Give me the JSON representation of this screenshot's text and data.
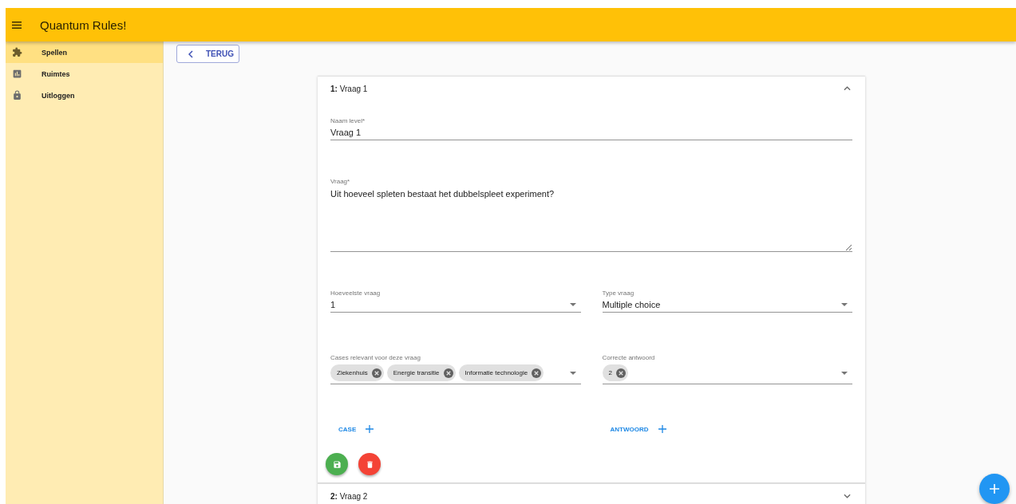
{
  "app_bar": {
    "title": "Quantum Rules!"
  },
  "sidebar": {
    "items": [
      {
        "label": "Spellen",
        "selected": true
      },
      {
        "label": "Ruimtes",
        "selected": false
      },
      {
        "label": "Uitloggen",
        "selected": false
      }
    ]
  },
  "back_button": {
    "label": "TERUG"
  },
  "questions": [
    {
      "number": "1:",
      "title": "Vraag 1",
      "expanded": true,
      "name_field": {
        "label": "Naam level*",
        "value": "Vraag 1"
      },
      "question_field": {
        "label": "Vraag*",
        "value": "Uit hoeveel spleten bestaat het dubbelspleet experiment?"
      },
      "order_select": {
        "label": "Hoeveelste vraag",
        "value": "1"
      },
      "type_select": {
        "label": "Type vraag",
        "value": "Multiple choice"
      },
      "cases_select": {
        "label": "Cases relevant voor deze vraag",
        "chips": [
          "Ziekenhuis",
          "Energie transitie",
          "Informatie technologie"
        ]
      },
      "answer_select": {
        "label": "Correcte antwoord",
        "chips": [
          "2"
        ]
      },
      "add_case_button": {
        "label": "CASE"
      },
      "add_answer_button": {
        "label": "ANTWOORD"
      }
    },
    {
      "number": "2:",
      "title": "Vraag 2",
      "expanded": false
    }
  ]
}
